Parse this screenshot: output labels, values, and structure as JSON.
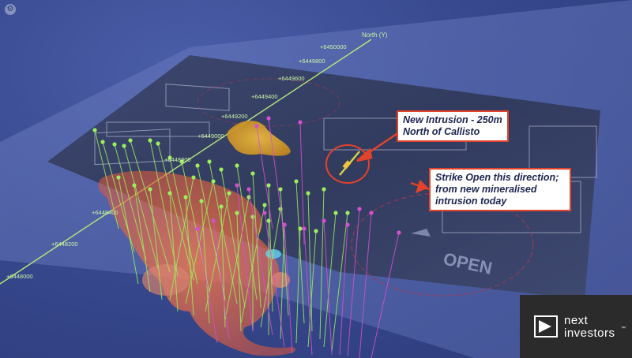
{
  "axis": {
    "label": "North (Y)",
    "ticks": [
      "+6450000",
      "+6449800",
      "+6449600",
      "+6449400",
      "+6449200",
      "+6449000",
      "+6448800",
      "+6448400",
      "+6448200",
      "+6448000"
    ]
  },
  "callouts": {
    "new_intrusion": "New Intrusion - 250m North of Callisto",
    "strike_open": "Strike Open this direction; from new mineralised intrusion today"
  },
  "map_labels": {
    "open": "OPEN"
  },
  "logo": {
    "line1": "next",
    "line2": "investors",
    "tm": "™"
  },
  "colors": {
    "background": "#2f3f7d",
    "callout_border": "#e2432a",
    "axis_line": "#b6ea7a",
    "intrusion_orange": "#e8643a",
    "intrusion_yellow": "#d8a12a",
    "drill_green": "#9cef5a",
    "drill_magenta": "#d64fd0"
  },
  "icons": {
    "top_left": "settings-icon",
    "logo_mark": "play-arrow-icon"
  }
}
